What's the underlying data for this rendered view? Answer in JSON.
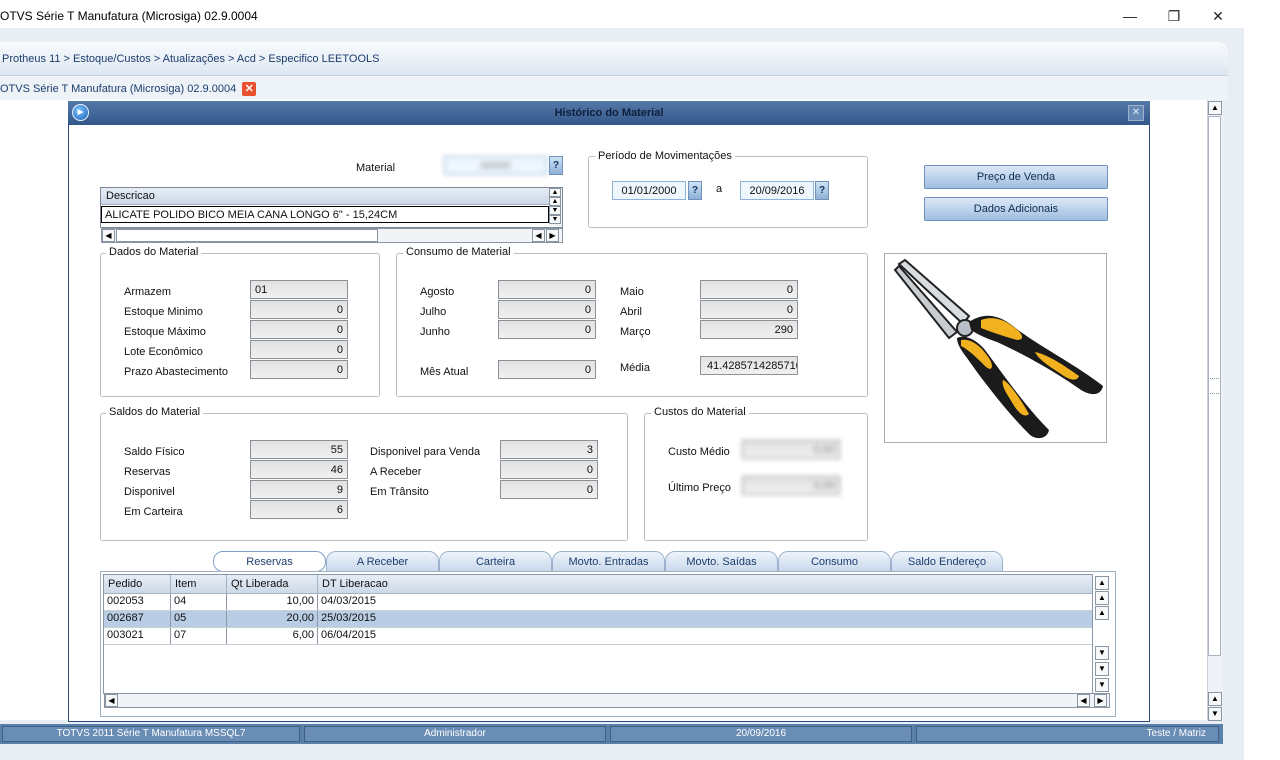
{
  "window": {
    "title": "OTVS Série T Manufatura (Microsiga) 02.9.0004",
    "minimize": "—",
    "restore": "❐",
    "close": "✕"
  },
  "breadcrumb": "Protheus 11 > Estoque/Custos > Atualizações > Acd > Especifico LEETOOLS",
  "doc_tab": {
    "label": "OTVS Série T Manufatura (Microsiga) 02.9.0004",
    "close": "✕"
  },
  "dialog": {
    "title": "Histórico do Material",
    "close": "✕",
    "material": {
      "label": "Material",
      "value": "00000",
      "help": "?"
    },
    "description_grid": {
      "header": "Descricao",
      "row": "ALICATE POLIDO BICO MEIA CANA LONGO 6\" - 15,24CM"
    },
    "period": {
      "title": "Período de Movimentações",
      "from": "01/01/2000",
      "sep": "a",
      "to": "20/09/2016",
      "help": "?"
    },
    "buttons": {
      "price": "Preço de Venda",
      "extra": "Dados Adicionais"
    },
    "dados_material": {
      "title": "Dados do Material",
      "fields": [
        {
          "label": "Armazem",
          "value": "01"
        },
        {
          "label": "Estoque Minimo",
          "value": "0"
        },
        {
          "label": "Estoque Máximo",
          "value": "0"
        },
        {
          "label": "Lote Econômico",
          "value": "0"
        },
        {
          "label": "Prazo Abastecimento",
          "value": "0"
        }
      ]
    },
    "consumo": {
      "title": "Consumo de Material",
      "left": [
        {
          "label": "Agosto",
          "value": "0"
        },
        {
          "label": "Julho",
          "value": "0"
        },
        {
          "label": "Junho",
          "value": "0"
        }
      ],
      "right": [
        {
          "label": "Maio",
          "value": "0"
        },
        {
          "label": "Abril",
          "value": "0"
        },
        {
          "label": "Março",
          "value": "290"
        }
      ],
      "mes_atual": {
        "label": "Mês Atual",
        "value": "0"
      },
      "media": {
        "label": "Média",
        "value": "41.4285714285710"
      }
    },
    "saldos": {
      "title": "Saldos do Material",
      "left": [
        {
          "label": "Saldo Físico",
          "value": "55"
        },
        {
          "label": "Reservas",
          "value": "46"
        },
        {
          "label": "Disponivel",
          "value": "9"
        },
        {
          "label": "Em Carteira",
          "value": "6"
        }
      ],
      "right": [
        {
          "label": "Disponivel para Venda",
          "value": "3"
        },
        {
          "label": "A Receber",
          "value": "0"
        },
        {
          "label": "Em Trânsito",
          "value": "0"
        }
      ]
    },
    "custos": {
      "title": "Custos do Material",
      "fields": [
        {
          "label": "Custo Médio",
          "value": "0,00"
        },
        {
          "label": "Último Preço",
          "value": "0,00"
        }
      ]
    },
    "tabs": [
      "Reservas",
      "A Receber",
      "Carteira",
      "Movto. Entradas",
      "Movto. Saídas",
      "Consumo",
      "Saldo Endereço"
    ],
    "table": {
      "columns": [
        "Pedido",
        "Item",
        "Qt Liberada",
        "DT Liberacao"
      ],
      "rows": [
        [
          "002053",
          "04",
          "10,00",
          "04/03/2015"
        ],
        [
          "002687",
          "05",
          "20,00",
          "25/03/2015"
        ],
        [
          "003021",
          "07",
          "6,00",
          "06/04/2015"
        ]
      ],
      "selected_row": 1
    },
    "image_icon": "pliers-image"
  },
  "statusbar": [
    "TOTVS 2011 Série T Manufatura MSSQL7",
    "Administrador",
    "20/09/2016",
    "Teste / Matriz"
  ],
  "colors": {
    "title_bar": "#34578a",
    "status_bar": "#5a7fa8",
    "selection": "#b9cde5",
    "plier_handle": "#f2b21f"
  }
}
